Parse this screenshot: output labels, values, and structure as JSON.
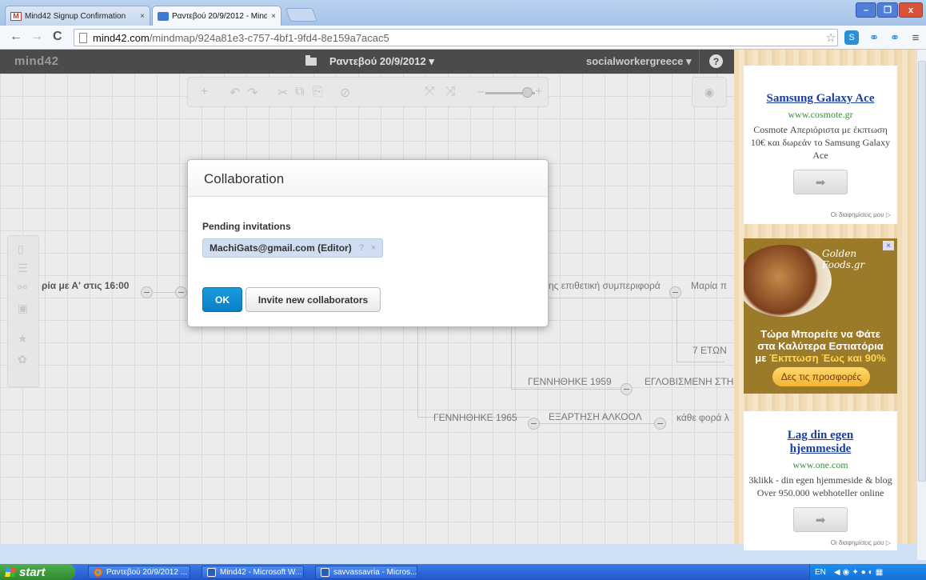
{
  "browser": {
    "tabs": [
      {
        "label": "Mind42 Signup Confirmation",
        "close": "×"
      },
      {
        "label": "Ραντεβού 20/9/2012 - Mind4",
        "close": "×"
      }
    ],
    "url_host": "mind42.com",
    "url_path": "/mindmap/924a81e3-c757-4bf1-9fd4-8e159a7acac5",
    "nav": {
      "back": "←",
      "forward": "→",
      "reload": "C"
    },
    "window_buttons": {
      "minimize": "–",
      "maximize": "❐",
      "close": "x"
    }
  },
  "app": {
    "logo": "mind42",
    "map_title": "Ραντεβού 20/9/2012 ▾",
    "user": "socialworkergreece ▾",
    "help": "?"
  },
  "toolbar_icons": [
    "+",
    "↶",
    "↷",
    "✂",
    "⧉",
    "⎘",
    "⊘",
    "⤧",
    "⤨",
    "–",
    "+"
  ],
  "map_nodes": {
    "left_node": "ρία με Α' στις 16:00",
    "node_behavior": "ης επιθετική συμπεριφορά",
    "node_maria": "Μαρία π",
    "node_7": "7 ΕΤΩΝ",
    "node_born_1959": "ΓΕΝΝΗΘΗΚΕ 1959",
    "node_institution": "ΕΓΛΟΒΙΣΜΕΝΗ ΣΤΗ",
    "node_born_1965": "ΓΕΝΝΗΘΗΚΕ 1965",
    "node_alcohol": "ΕΞΑΡΤΗΣΗ ΑΛΚΟΟΛ",
    "node_every_time": "κάθε φορά λ"
  },
  "modal": {
    "title": "Collaboration",
    "pending_heading": "Pending invitations",
    "invitee": "MachiGats@gmail.com (Editor)",
    "invitee_help": "?",
    "invitee_remove": "×",
    "ok_label": "OK",
    "invite_label": "Invite new collaborators"
  },
  "ads": {
    "ad1": {
      "title": "Samsung Galaxy Ace",
      "url": "www.cosmote.gr",
      "text": "Cosmote Απεριόριστα με έκπτωση 10€ και δωρεάν το Samsung Galaxy Ace",
      "arrow": "➡",
      "interests": "Οι διαφημίσεις μου ▷"
    },
    "ad2": {
      "logo": "Golden Foods.gr",
      "close": "×",
      "headline_1": "Τώρα Μπορείτε να Φάτε",
      "headline_2": "στα Καλύτερα Εστιατόρια",
      "headline_3_prefix": "με ",
      "headline_3_highlight": "Έκπτωση Έως και 90%",
      "cta": "Δες τις προσφορές"
    },
    "ad3": {
      "title": "Lag din egen hjemmeside",
      "url": "www.one.com",
      "text": "3klikk - din egen hjemmeside & blog Over 950.000 webhoteller online",
      "arrow": "➡",
      "interests": "Οι διαφημίσεις μου ▷"
    }
  },
  "taskbar": {
    "start": "start",
    "tasks": [
      "Ραντεβού 20/9/2012 ...",
      "Mind42 - Microsoft W...",
      "savvassavria - Micros..."
    ],
    "tray_lang": "EN"
  },
  "colors": {
    "accent": "#0a7fc4",
    "chip": "#cfdef1",
    "header": "#4b4b4b",
    "ad_link": "#1a3ea0"
  }
}
